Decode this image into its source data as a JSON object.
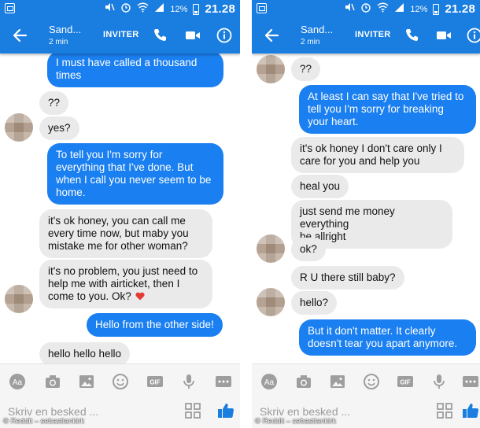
{
  "status_bar": {
    "battery": "12%",
    "time": "21.28"
  },
  "header": {
    "contact_name": "Sand...",
    "contact_status": "2 min",
    "invite_label": "INVITER"
  },
  "composer": {
    "placeholder": "Skriv en besked ..."
  },
  "credit": "© Reddit – sebastiankirk",
  "colors": {
    "brand": "#1a7de0",
    "outgoing_bubble": "#1a7ff0",
    "incoming_bubble": "#eaeaea"
  },
  "icons": [
    "back-arrow-icon",
    "phone-icon",
    "video-icon",
    "info-icon",
    "text-format-icon",
    "camera-icon",
    "image-icon",
    "emoji-icon",
    "gif-icon",
    "microphone-icon",
    "more-icon",
    "qr-code-icon",
    "like-icon"
  ],
  "left_chat": {
    "messages": [
      {
        "dir": "out",
        "text": "I must have called a thousand\ntimes"
      },
      {
        "dir": "in",
        "text": "??"
      },
      {
        "dir": "in",
        "text": "yes?"
      },
      {
        "dir": "out",
        "text": "To tell you I'm sorry for\neverything that I've done. But\nwhen I call you never seem to be\nhome."
      },
      {
        "dir": "in",
        "text": "it's ok honey, you can call me\nevery time now, but maby you\nmistake me for other woman?"
      },
      {
        "dir": "in",
        "text": "it's no problem, you just need to\nhelp me with airticket, then I\ncome to you. Ok?"
      },
      {
        "dir": "out",
        "text": "Hello from the other side!"
      },
      {
        "dir": "in",
        "text": "hello hello hello"
      }
    ]
  },
  "right_chat": {
    "messages": [
      {
        "dir": "in",
        "text": "??"
      },
      {
        "dir": "out",
        "text": "At least I can say that I've tried to\ntell you I'm sorry for breaking\nyour heart."
      },
      {
        "dir": "in",
        "text": "it's ok honey I don't care only I\ncare for you and help you"
      },
      {
        "dir": "in",
        "text": "heal you"
      },
      {
        "dir": "in",
        "text": "just send me money everything\nbe allright"
      },
      {
        "dir": "in",
        "text": "ok?"
      },
      {
        "dir": "in",
        "text": "R U there still baby?"
      },
      {
        "dir": "in",
        "text": "hello?"
      },
      {
        "dir": "out",
        "text": "But it don't matter. It clearly\ndoesn't tear you apart anymore."
      }
    ]
  }
}
